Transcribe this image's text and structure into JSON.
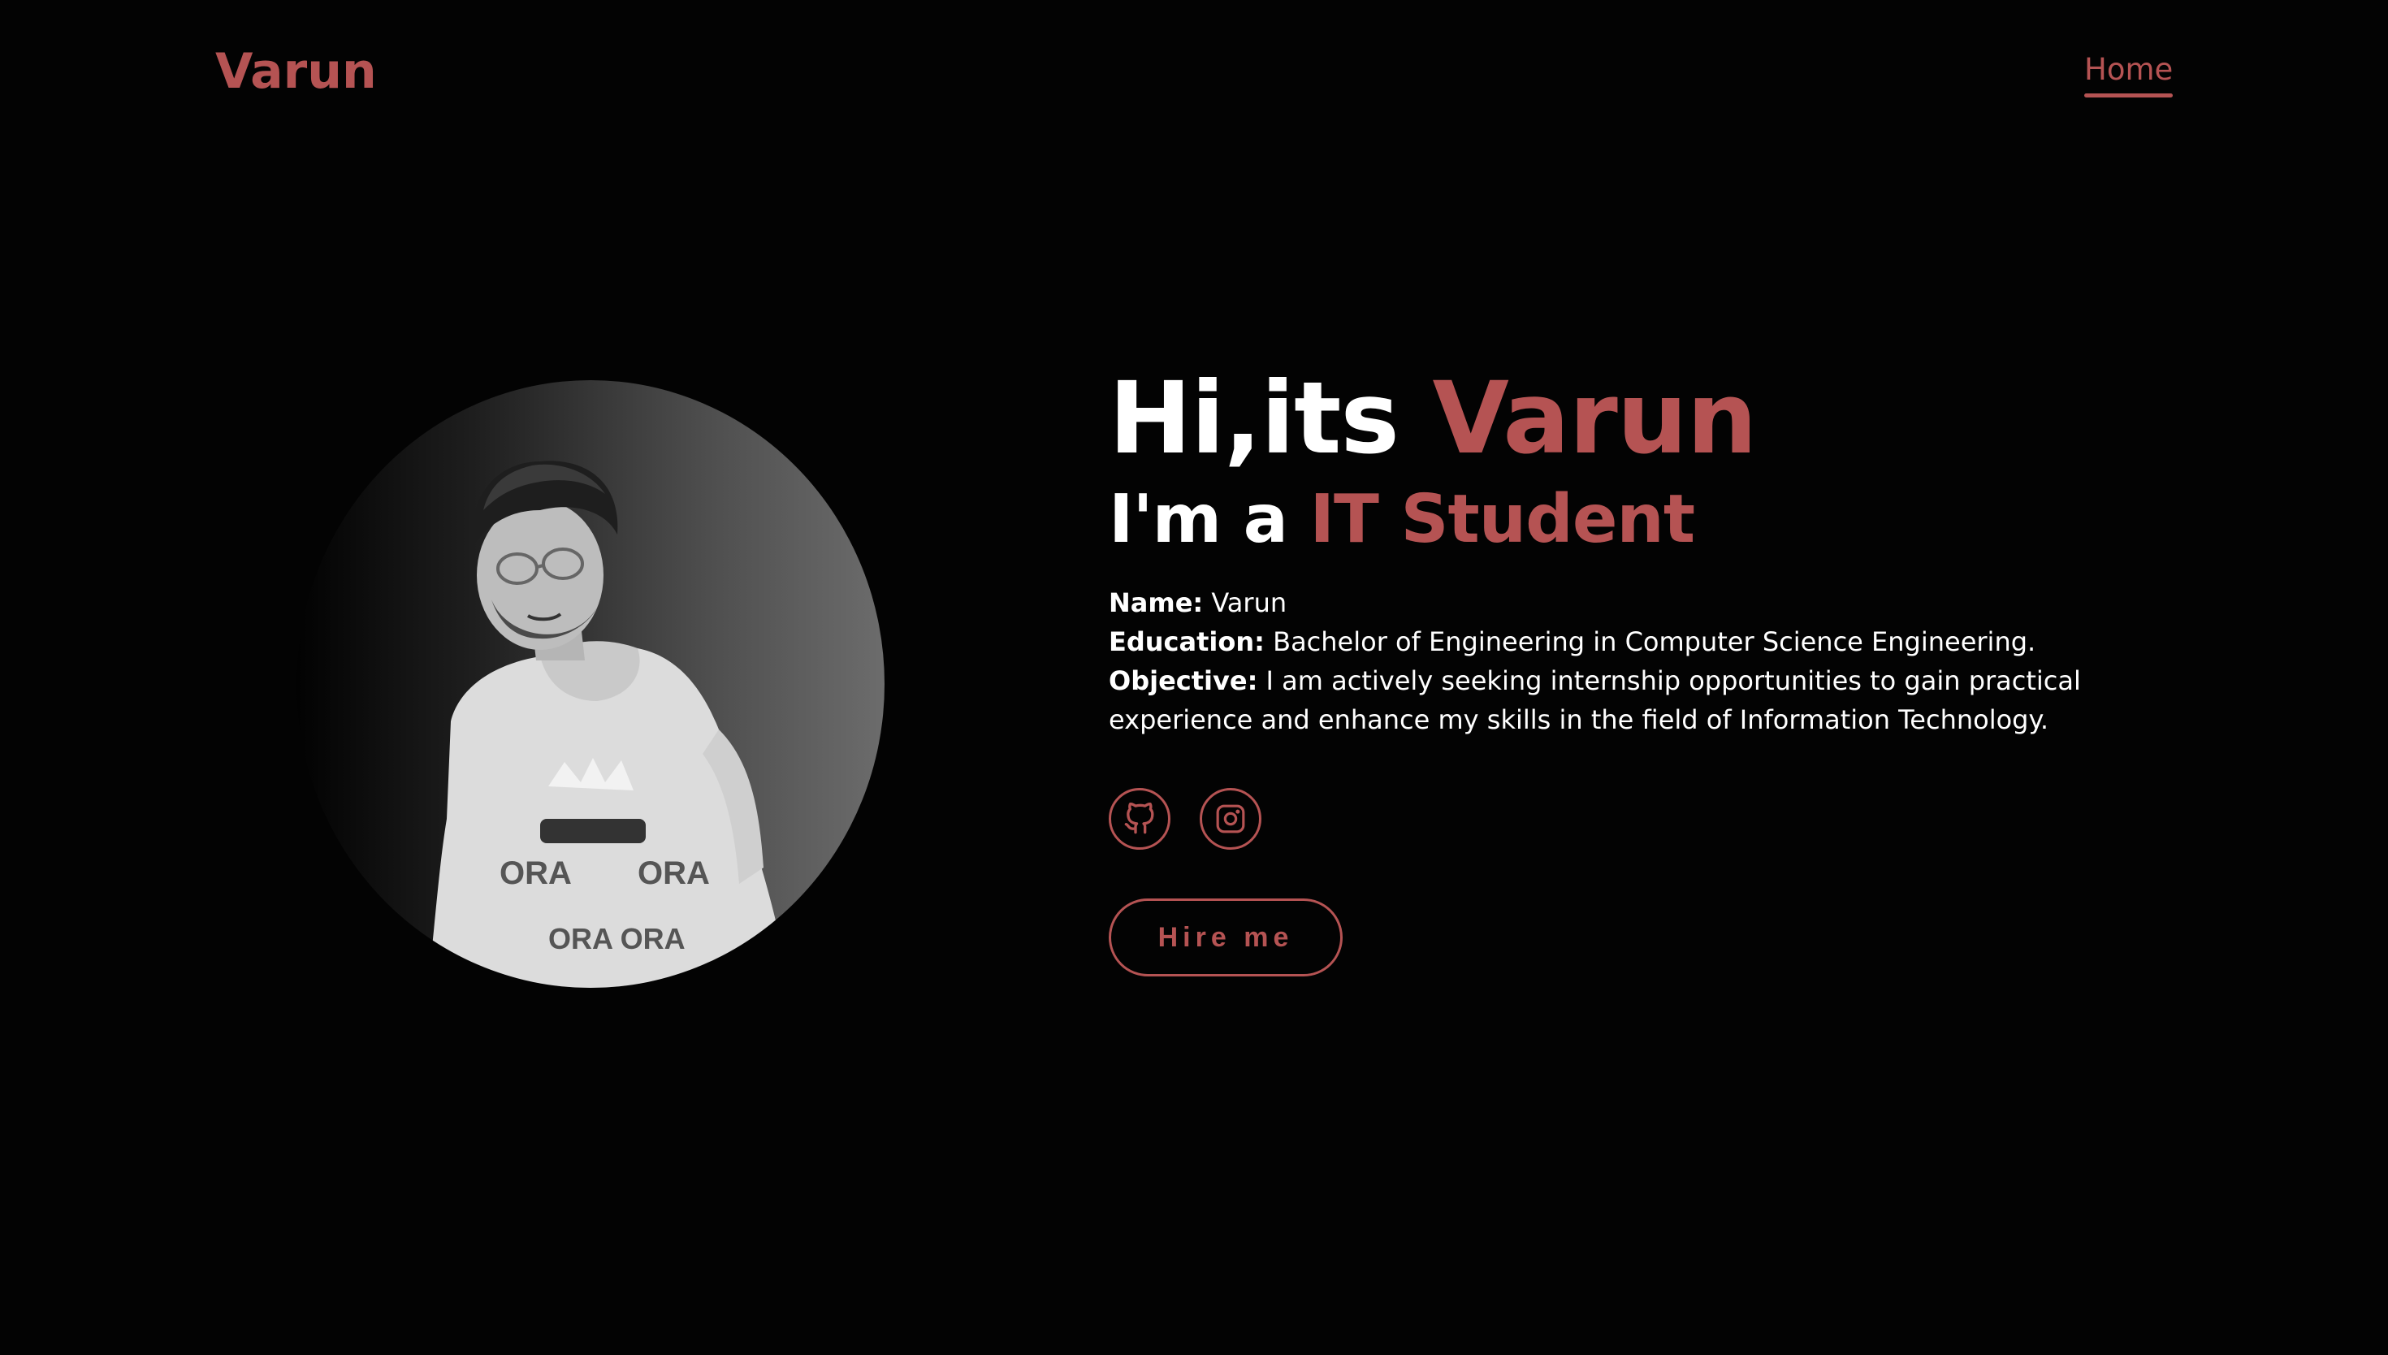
{
  "header": {
    "logo": "Varun",
    "nav": [
      {
        "label": "Home",
        "active": true
      }
    ]
  },
  "hero": {
    "photo_alt": "portrait-photo",
    "greeting_prefix": "Hi,its ",
    "greeting_name": "Varun",
    "role_prefix": "I'm a ",
    "role_highlight": "IT Student",
    "details": {
      "name_label": "Name:",
      "name_value": " Varun",
      "education_label": "Education:",
      "education_value": " Bachelor of Engineering in Computer Science Engineering.",
      "objective_label": "Objective:",
      "objective_value": " I am actively seeking internship opportunities to gain practical experience and enhance my skills in the field of Information Technology."
    },
    "socials": [
      {
        "icon": "github-icon"
      },
      {
        "icon": "instagram-icon"
      }
    ],
    "cta_label": "Hire me"
  },
  "colors": {
    "background": "#030303",
    "accent": "#b55353",
    "text": "#ffffff"
  }
}
